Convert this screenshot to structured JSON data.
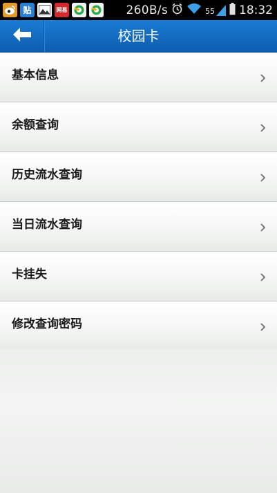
{
  "status_bar": {
    "notifications": [
      {
        "icon": "weibo-icon",
        "text": ""
      },
      {
        "icon": "tieba-icon",
        "text": "贴"
      },
      {
        "icon": "gallery-icon",
        "text": ""
      },
      {
        "icon": "netease-news-icon",
        "text": "网易"
      },
      {
        "icon": "app-store-icon",
        "text": ""
      },
      {
        "icon": "app-store-icon",
        "text": ""
      }
    ],
    "net_speed": "260B/s",
    "signal_label": "55",
    "time": "18:32"
  },
  "header": {
    "title": "校园卡",
    "back_icon": "back-arrow-icon",
    "color": "#1468c0"
  },
  "menu": {
    "items": [
      {
        "label": "基本信息"
      },
      {
        "label": "余额查询"
      },
      {
        "label": "历史流水查询"
      },
      {
        "label": "当日流水查询"
      },
      {
        "label": "卡挂失"
      },
      {
        "label": "修改查询密码"
      }
    ],
    "chevron_icon": "chevron-right-icon"
  }
}
